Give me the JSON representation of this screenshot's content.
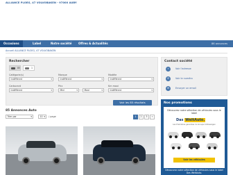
{
  "header": {
    "brand": "ALLIANCE PLOEG, 47 VOLVOBAKEN - 97000 AUBY"
  },
  "nav": {
    "tabs": [
      {
        "label": "Occasions"
      },
      {
        "label": "Label"
      },
      {
        "label": "Notre société"
      },
      {
        "label": "Offres & Actualités"
      }
    ],
    "count": "86 annonces"
  },
  "breadcrumb": "Accueil ALLIANCE PLOEG, 47 VOLVOBAKEN",
  "search": {
    "title": "Rechercher",
    "vehicle_types": [
      {
        "icon": "car-icon",
        "count": "85"
      },
      {
        "icon": "van-icon",
        "count": "1"
      }
    ],
    "fields": [
      {
        "label": "Catégorie(s)",
        "value": "Indifférent"
      },
      {
        "label": "Marque",
        "value": "Indifférent"
      },
      {
        "label": "Modèle",
        "value": "Indifférent"
      },
      {
        "label": "Carburant",
        "value": "Indifférent"
      },
      {
        "label": "Prix",
        "value_min": "Mini",
        "value_max": "Maxi"
      },
      {
        "label": "Km maxi",
        "value": "Indifférent"
      }
    ],
    "results_button": "Voir les 85 résultats"
  },
  "contact": {
    "title": "Contact société",
    "items": [
      {
        "icon": "location-icon",
        "text": "Voir l'adresse"
      },
      {
        "icon": "phone-icon",
        "text": "Voir le numéro"
      },
      {
        "icon": "mail-icon",
        "text": "Envoyer un email"
      }
    ]
  },
  "listing": {
    "title": "85 Annonces Auto",
    "sort_value": "Trier par",
    "per_page_value": "10",
    "per_page_label": "/ page",
    "pages": [
      "1",
      "2",
      "3"
    ],
    "next": "»"
  },
  "promo": {
    "title": "Nos promotions",
    "ad_text": "Découvrez notre sélection de véhicules sous le label",
    "ad_logo_prefix": "Das",
    "ad_logo_brand": "WeltAuto.",
    "ad_tagline": "Les Premières garanties du Groupe Volkswagen",
    "ad_button": "Voir les véhicules",
    "under_text": "Découvrez notre sélection de véhicules sous le label  Das WeltAuto."
  }
}
